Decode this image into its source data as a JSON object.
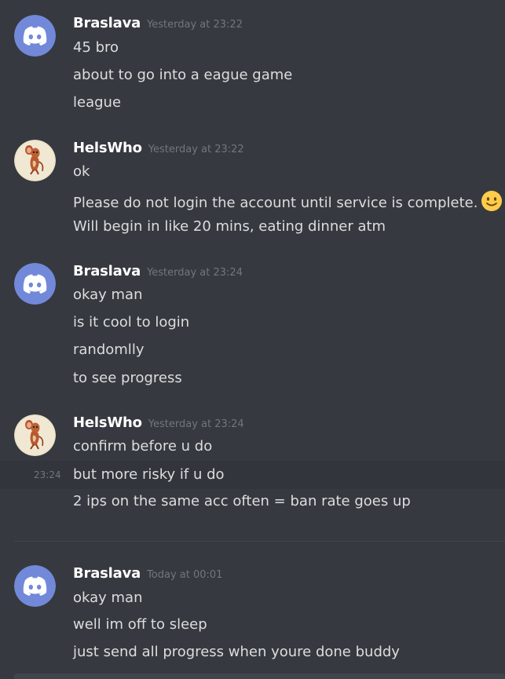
{
  "colors": {
    "background": "#36393f",
    "username": "#ffffff",
    "message_text": "#dcddde",
    "timestamp": "#72767d",
    "discord_blurple": "#7289da"
  },
  "messages": [
    {
      "author": "Braslava",
      "avatar_icon": "discord-logo-icon",
      "timestamp": "Yesterday at 23:22",
      "lines": [
        "45 bro",
        "about to go into a eague game",
        "league"
      ]
    },
    {
      "author": "HelsWho",
      "avatar_icon": "cartoon-mouse-avatar-icon",
      "timestamp": "Yesterday at 23:22",
      "lines": [
        "ok",
        "Please do not login the account until service is complete.",
        "Will begin in like 20 mins, eating dinner atm"
      ]
    },
    {
      "author": "Braslava",
      "avatar_icon": "discord-logo-icon",
      "timestamp": "Yesterday at 23:24",
      "lines": [
        "okay man",
        "is it cool to login",
        "randomlly",
        "to see progress"
      ]
    },
    {
      "author": "HelsWho",
      "avatar_icon": "cartoon-mouse-avatar-icon",
      "timestamp": "Yesterday at 23:24",
      "hover_time": "23:24",
      "lines": [
        "confirm before u do",
        "but more risky if u do",
        "2 ips on the same acc often = ban rate goes up"
      ]
    },
    {
      "author": "Braslava",
      "avatar_icon": "discord-logo-icon",
      "timestamp": "Today at 00:01",
      "lines": [
        "okay man",
        "well im off to sleep",
        "just send all progress when youre done buddy"
      ]
    }
  ]
}
